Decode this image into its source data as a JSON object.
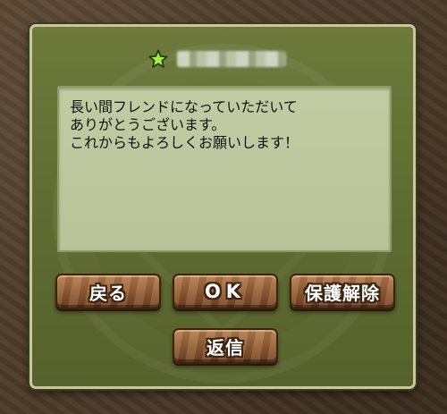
{
  "dialog": {
    "accent_color": "#5f6c31",
    "border_color": "#c8c99a",
    "friend_rank_icon": "green-star-icon",
    "friend_name": "",
    "message_lines": [
      "長い間フレンドになっていただいて",
      "ありがとうございます。",
      "これからもよろしくお願いします！"
    ]
  },
  "buttons": {
    "back_label": "戻る",
    "ok_label": "OK",
    "unlock_label": "保護解除",
    "reply_label": "返信",
    "button_color": "#8e5a33"
  }
}
